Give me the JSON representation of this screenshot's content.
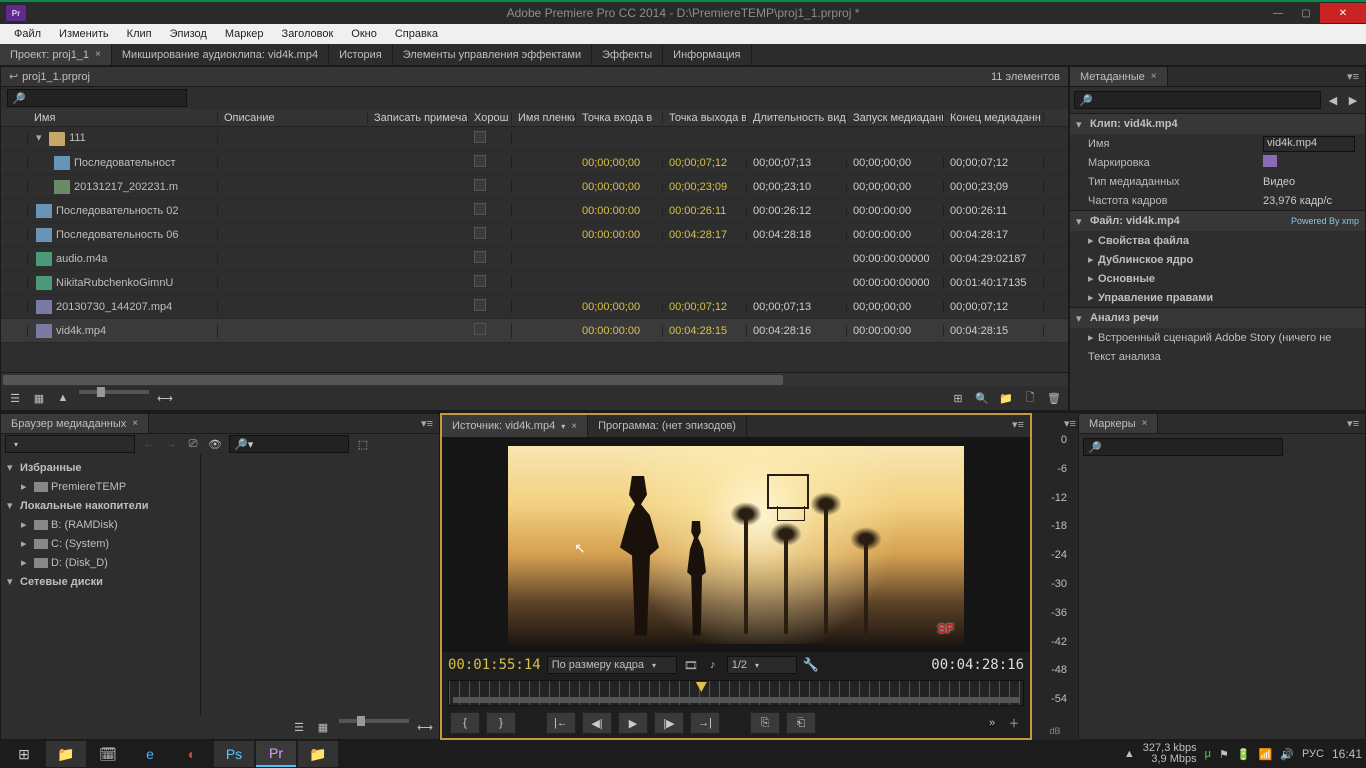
{
  "title": "Adobe Premiere Pro CC 2014 - D:\\PremiereTEMP\\proj1_1.prproj *",
  "app_icon_label": "Pr",
  "menubar": [
    "Файл",
    "Изменить",
    "Клип",
    "Эпизод",
    "Маркер",
    "Заголовок",
    "Окно",
    "Справка"
  ],
  "top_tabs": [
    {
      "label": "Проект: proj1_1",
      "active": true,
      "closable": true
    },
    {
      "label": "Микширование аудиоклипа: vid4k.mp4",
      "active": false,
      "closable": false
    },
    {
      "label": "История",
      "active": false,
      "closable": false
    },
    {
      "label": "Элементы управления эффектами",
      "active": false,
      "closable": false
    },
    {
      "label": "Эффекты",
      "active": false,
      "closable": false
    },
    {
      "label": "Информация",
      "active": false,
      "closable": false
    }
  ],
  "project": {
    "breadcrumb": "proj1_1.prproj",
    "count_label": "11 элементов",
    "columns": [
      "",
      "Имя",
      "Описание",
      "Записать примеча",
      "Хорош",
      "Имя пленки",
      "Точка входа в",
      "Точка выхода в",
      "Длительность вид",
      "Запуск медиаданн",
      "Конец медиаданн"
    ],
    "rows": [
      {
        "color": "#c79a3a",
        "indent": 0,
        "icon": "folder",
        "name": "111",
        "good": true
      },
      {
        "color": "#2a9a4a",
        "indent": 1,
        "icon": "seq",
        "name": "Последовательност",
        "good": false,
        "in": "00;00;00;00",
        "out": "00;00;07;12",
        "dur": "00;00;07;13",
        "mstart": "00;00;00;00",
        "mend": "00;00;07;12"
      },
      {
        "color": "#7a7aa6",
        "indent": 1,
        "icon": "clip",
        "name": "20131217_202231.m",
        "good": false,
        "in": "00;00;00;00",
        "out": "00;00;23;09",
        "dur": "00;00;23;10",
        "mstart": "00;00;00;00",
        "mend": "00;00;23;09"
      },
      {
        "color": "#2a9a4a",
        "indent": 0,
        "icon": "seq",
        "name": "Последовательность 02",
        "good": false,
        "in": "00:00:00:00",
        "out": "00:00:26:11",
        "dur": "00:00:26:12",
        "mstart": "00:00:00:00",
        "mend": "00:00:26:11"
      },
      {
        "color": "#2a9a4a",
        "indent": 0,
        "icon": "seq",
        "name": "Последовательность 06",
        "good": false,
        "in": "00:00:00:00",
        "out": "00:04:28:17",
        "dur": "00:04:28:18",
        "mstart": "00:00:00:00",
        "mend": "00:04:28:17"
      },
      {
        "color": "#4a9a7a",
        "indent": 0,
        "icon": "aud",
        "name": "audio.m4a",
        "good": false,
        "mstart": "00:00:00:00000",
        "mend": "00:04:29:02187"
      },
      {
        "color": "#4a9a7a",
        "indent": 0,
        "icon": "aud",
        "name": "NikitaRubchenkoGimnU",
        "good": false,
        "mstart": "00:00:00:00000",
        "mend": "00:01:40:17135"
      },
      {
        "color": "#7a7aa6",
        "indent": 0,
        "icon": "vid",
        "name": "20130730_144207.mp4",
        "good": false,
        "in": "00;00;00;00",
        "out": "00;00;07;12",
        "dur": "00;00;07;13",
        "mstart": "00;00;00;00",
        "mend": "00;00;07;12"
      },
      {
        "color": "#7a7aa6",
        "indent": 0,
        "icon": "vid",
        "name": "vid4k.mp4",
        "good": false,
        "in": "00:00:00:00",
        "out": "00:04:28:15",
        "dur": "00:04:28:16",
        "mstart": "00:00:00:00",
        "mend": "00:04:28:15",
        "selected": true
      }
    ]
  },
  "metadata": {
    "panel_title": "Метаданные",
    "clip_section": "Клип:  vid4k.mp4",
    "rows": [
      {
        "label": "Имя",
        "value": "vid4k.mp4",
        "editable": true
      },
      {
        "label": "Маркировка",
        "value": "",
        "swatch": "#8a6ab5"
      },
      {
        "label": "Тип медиаданных",
        "value": "Видео"
      },
      {
        "label": "Частота кадров",
        "value": "23,976 кадр/с"
      }
    ],
    "file_section": "Файл:  vid4k.mp4",
    "xmp": "Powered By  xmp",
    "file_subsections": [
      "Свойства файла",
      "Дублинское ядро",
      "Основные",
      "Управление правами"
    ],
    "speech_section": "Анализ речи",
    "story_item": "Встроенный сценарий Adobe Story (ничего не",
    "analysis": "Текст анализа"
  },
  "browser": {
    "panel_title": "Браузер медиаданных",
    "favorites": "Избранные",
    "fav_items": [
      "PremiereTEMP"
    ],
    "local": "Локальные накопители",
    "drives": [
      "B: (RAMDisk)",
      "C: (System)",
      "D: (Disk_D)"
    ],
    "network": "Сетевые диски"
  },
  "source": {
    "tab_label": "Источник: vid4k.mp4",
    "program_tab": "Программа: (нет эпизодов)",
    "current_tc": "00:01:55:14",
    "fit_label": "По размеру кадра",
    "res_label": "1/2",
    "duration_tc": "00:04:28:16",
    "logo": "SF"
  },
  "meter": {
    "ticks": [
      "0",
      "-6",
      "-12",
      "-18",
      "-24",
      "-30",
      "-36",
      "-42",
      "-48",
      "-54",
      ""
    ],
    "unit": "dB"
  },
  "markers": {
    "panel_title": "Маркеры"
  },
  "taskbar": {
    "net_speed": "327,3 kbps",
    "net_data": "3,9 Mbps",
    "lang": "РУС",
    "clock": "16:41"
  }
}
